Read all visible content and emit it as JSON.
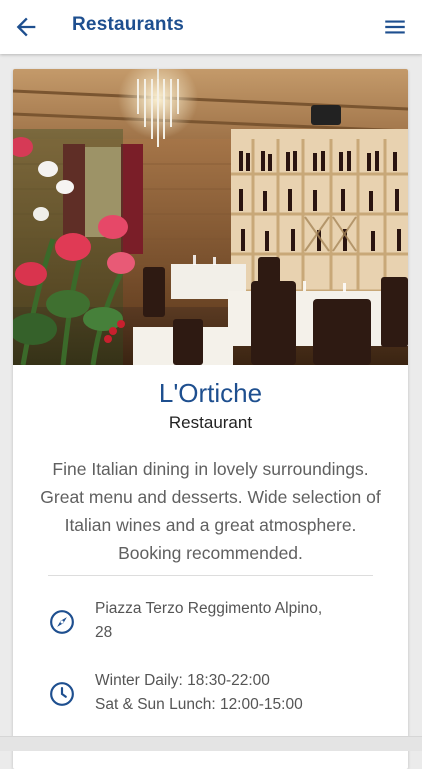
{
  "header": {
    "title": "Restaurants",
    "back_icon": "arrow-left-icon",
    "menu_icon": "hamburger-menu-icon"
  },
  "restaurant": {
    "name": "L'Ortiche",
    "category": "Restaurant",
    "description": "Fine Italian dining in lovely surroundings. Great menu and desserts. Wide selection of Italian wines and a great atmosphere. Booking recommended.",
    "address_lines": [
      "Piazza Terzo Reggimento Alpino,",
      "28"
    ],
    "hours_lines": [
      "Winter Daily: 18:30-22:00",
      "Sat & Sun Lunch: 12:00-15:00"
    ],
    "address_icon": "compass-icon",
    "hours_icon": "clock-icon"
  },
  "colors": {
    "accent": "#1e4f8f",
    "background": "#ebebeb",
    "text_secondary": "#606060"
  }
}
